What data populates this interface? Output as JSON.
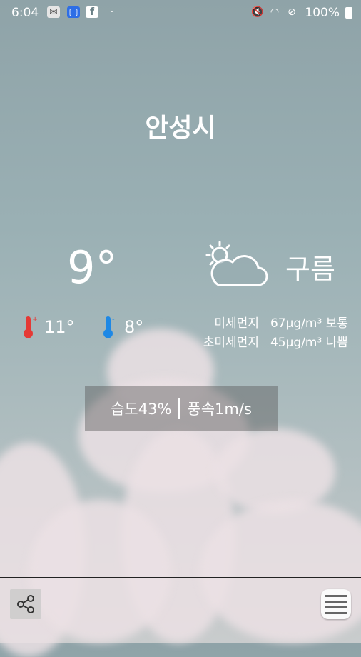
{
  "status_bar": {
    "time": "6:04",
    "battery": "100%"
  },
  "city": "안성시",
  "weather": {
    "temperature": "9°",
    "condition": "구름",
    "high": "11°",
    "low": "8°"
  },
  "dust": {
    "fine_label": "미세먼지",
    "fine_value": "67μg/m³ 보통",
    "ultrafine_label": "초미세먼지",
    "ultrafine_value": "45μg/m³ 나쁨"
  },
  "details": {
    "humidity": "습도43%",
    "wind": "풍속1m/s"
  },
  "colors": {
    "high_temp_icon": "#e53935",
    "low_temp_icon": "#1e88e5"
  }
}
